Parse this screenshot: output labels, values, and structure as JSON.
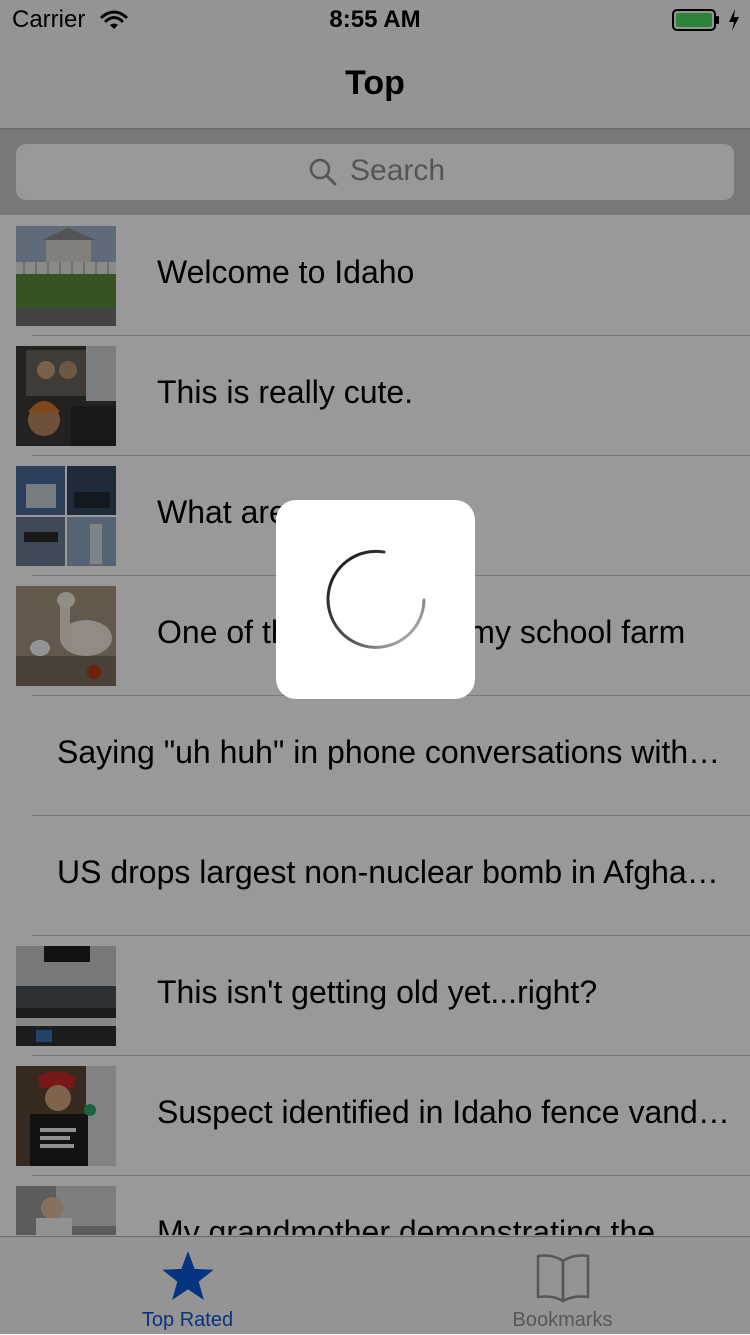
{
  "status_bar": {
    "carrier": "Carrier",
    "time": "8:55 AM",
    "battery_color": "#4cd964"
  },
  "nav": {
    "title": "Top"
  },
  "search": {
    "placeholder": "Search"
  },
  "rows": [
    {
      "title": "Welcome to Idaho",
      "has_image": true
    },
    {
      "title": "This is really cute.",
      "has_image": true
    },
    {
      "title": "What are",
      "has_image": true
    },
    {
      "title": "One of the animals in my school farm",
      "has_image": true
    },
    {
      "title": "Saying \"uh huh\" in phone conversations without listening",
      "has_image": false
    },
    {
      "title": "US drops largest non-nuclear bomb in Afghanistan",
      "has_image": false
    },
    {
      "title": "This isn't getting old yet...right?",
      "has_image": true
    },
    {
      "title": "Suspect identified in Idaho fence vandalism",
      "has_image": true
    },
    {
      "title": "My grandmother demonstrating the",
      "has_image": true
    }
  ],
  "tabbar": {
    "tabs": [
      {
        "label": "Top Rated",
        "icon": "star-icon",
        "active": true
      },
      {
        "label": "Bookmarks",
        "icon": "book-icon",
        "active": false
      }
    ],
    "active_color": "#0a57d6",
    "inactive_color": "#929292"
  },
  "loading": {
    "indicator": "spinner"
  }
}
